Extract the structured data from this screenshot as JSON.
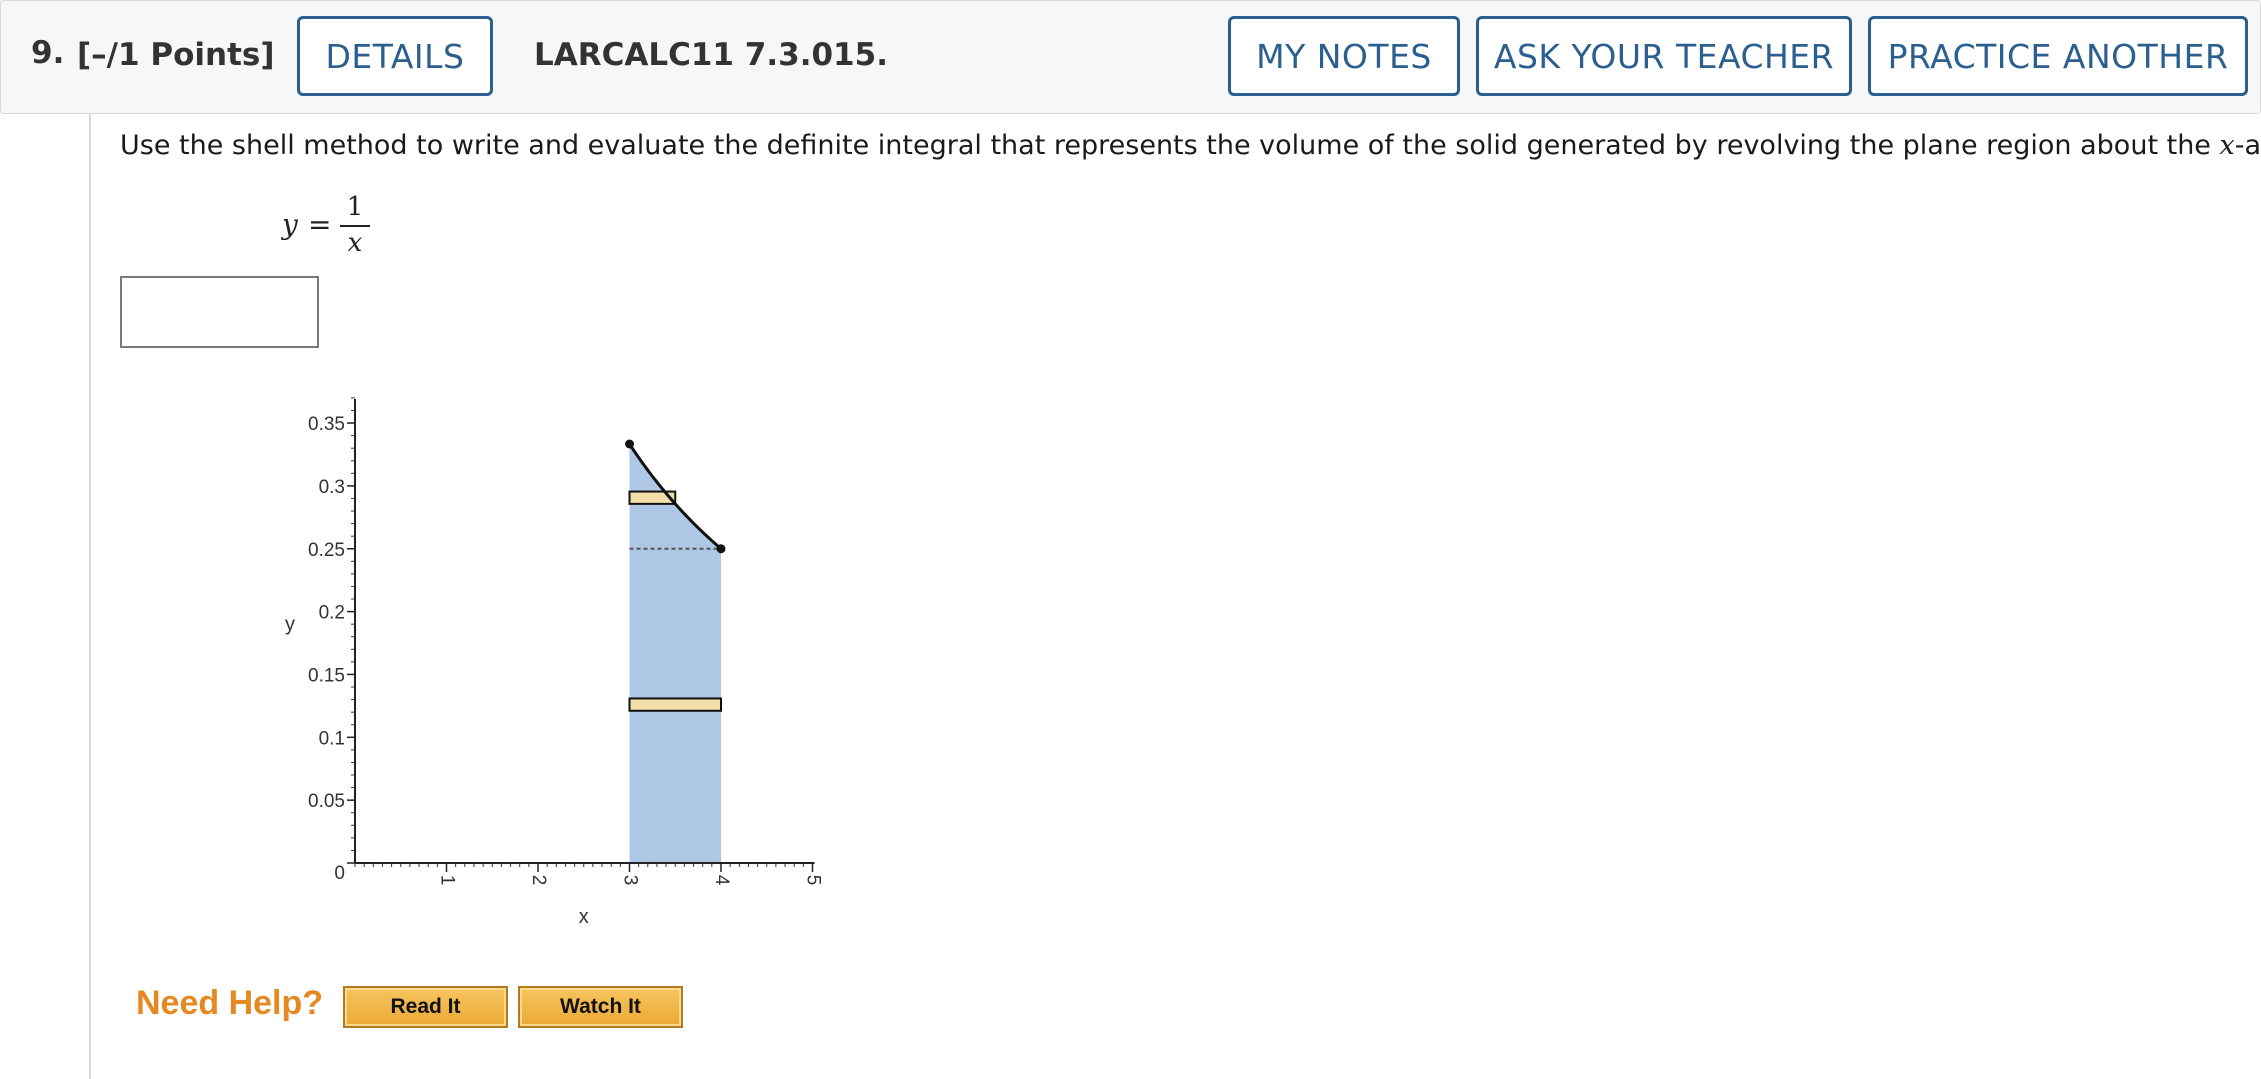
{
  "header": {
    "number": "9.",
    "points": "[–/1 Points]",
    "details_label": "DETAILS",
    "code": "LARCALC11 7.3.015.",
    "my_notes_label": "MY NOTES",
    "ask_teacher_label": "ASK YOUR TEACHER",
    "practice_label": "PRACTICE ANOTHER",
    "accent_color": "#2b5f8f"
  },
  "question": {
    "prompt_before": "Use the shell method to write and evaluate the definite integral that represents the volume of the solid generated by revolving the plane region about the ",
    "prompt_var": "x",
    "prompt_after": "-axis.",
    "equation": {
      "lhs": "y",
      "eq": "=",
      "numerator": "1",
      "denominator": "x"
    },
    "answer_value": ""
  },
  "chart_data": {
    "type": "area",
    "xlabel": "x",
    "ylabel": "y",
    "xlim": [
      0,
      5
    ],
    "ylim": [
      0,
      0.35
    ],
    "x_ticks": [
      "1",
      "2",
      "3",
      "4",
      "5"
    ],
    "y_ticks": [
      "0",
      "0.05",
      "0.1",
      "0.15",
      "0.2",
      "0.25",
      "0.3",
      "0.35"
    ],
    "curve": {
      "function": "1/x",
      "x_from": 3,
      "x_to": 4
    },
    "region": {
      "x_from": 3,
      "x_to": 4,
      "fill": "#aec7e5"
    },
    "dashed_level": 0.25,
    "shells": [
      {
        "x_from": 3,
        "x_to": 3.5,
        "y_from": 0.2857,
        "y_to": 0.2955
      },
      {
        "x_from": 3,
        "x_to": 4,
        "y_from": 0.1211,
        "y_to": 0.1309
      }
    ],
    "shell_fill": "#f2dfa7",
    "grid": false
  },
  "help": {
    "label": "Need Help?",
    "read_label": "Read It",
    "watch_label": "Watch It",
    "label_color": "#e58a22"
  }
}
